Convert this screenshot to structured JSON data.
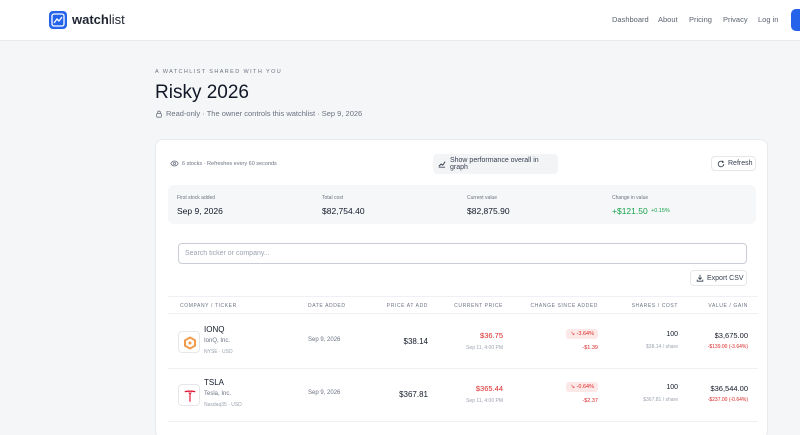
{
  "header": {
    "brand_bold": "watch",
    "brand_light": "list",
    "nav": [
      "Dashboard",
      "About",
      "Pricing",
      "Privacy",
      "Log in"
    ]
  },
  "hero": {
    "eyebrow": "A WATCHLIST SHARED WITH YOU",
    "title": "Risky 2026",
    "meta": "Read-only · The owner controls this watchlist · Sep 9, 2026"
  },
  "toolbar": {
    "info": "6 stocks · Refreshes every 60 seconds",
    "performance_label": "Show performance overall in graph",
    "refresh_label": "Refresh"
  },
  "stats": [
    {
      "label": "First stock added",
      "value": "Sep 9, 2026"
    },
    {
      "label": "Total cost",
      "value": "$82,754.40"
    },
    {
      "label": "Current value",
      "value": "$82,875.90"
    },
    {
      "label": "Change in value",
      "value": "+$121.50",
      "pct": "+0.15%"
    }
  ],
  "search": {
    "placeholder": "Search ticker or company...",
    "value": ""
  },
  "export_label": "Export CSV",
  "table": {
    "columns": [
      "COMPANY / TICKER",
      "DATE ADDED",
      "PRICE AT ADD",
      "CURRENT PRICE",
      "CHANGE SINCE ADDED",
      "SHARES / COST",
      "VALUE / GAIN"
    ],
    "rows": [
      {
        "ticker": "IONQ",
        "company": "IonQ, Inc.",
        "exchange": "NYSE · USD",
        "date_added": "Sep 9, 2026",
        "price_at_add": "$38.14",
        "current_price": "$36.75",
        "current_time": "Sep 11, 4:00 PM",
        "change_pct": "↘ -3.64%",
        "change_abs": "-$1.39",
        "shares": "100",
        "cost_per_share": "$38.14 / share",
        "value": "$3,675.00",
        "gain": "-$139.00 (-3.64%)"
      },
      {
        "ticker": "TSLA",
        "company": "Tesla, Inc.",
        "exchange": "Nasdaq35 · USD",
        "date_added": "Sep 9, 2026",
        "price_at_add": "$367.81",
        "current_price": "$365.44",
        "current_time": "Sep 11, 4:00 PM",
        "change_pct": "↘ -0.64%",
        "change_abs": "-$2.37",
        "shares": "100",
        "cost_per_share": "$367.81 / share",
        "value": "$36,544.00",
        "gain": "-$237.00 (-0.64%)"
      }
    ]
  },
  "icons": {
    "logo": "chart-icon",
    "lock": "lock-icon",
    "eye": "eye-icon",
    "graph": "chart-line-icon",
    "refresh": "refresh-icon",
    "download": "download-icon"
  },
  "colors": {
    "accent": "#2563eb",
    "negative": "#dc2626",
    "positive": "#16a34a"
  }
}
